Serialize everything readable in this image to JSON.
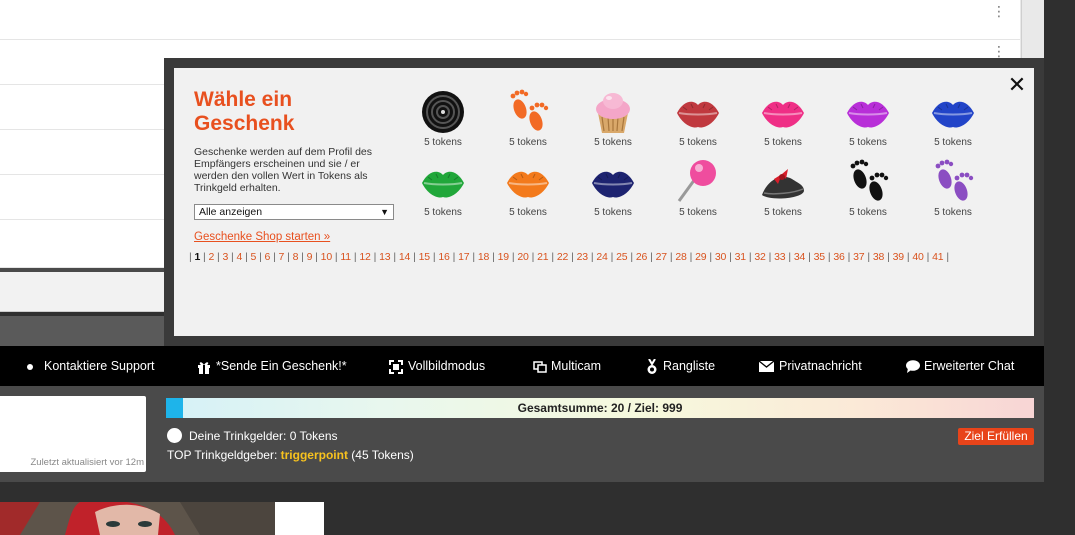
{
  "modal": {
    "title": "Wähle ein Geschenk",
    "description": "Geschenke werden auf dem Profil des Empfängers erscheinen und sie / er werden den vollen Wert in Tokens als Trinkgeld erhalten.",
    "filter_selected": "Alle anzeigen",
    "shop_link": "Geschenke Shop starten »",
    "close_glyph": "✕",
    "gifts": [
      {
        "icon": "licorice-wheel-icon",
        "label": "5 tokens"
      },
      {
        "icon": "orange-footprints-icon",
        "label": "5 tokens"
      },
      {
        "icon": "cupcake-icon",
        "label": "5 tokens"
      },
      {
        "icon": "red-lips-icon",
        "label": "5 tokens"
      },
      {
        "icon": "pink-lips-icon",
        "label": "5 tokens"
      },
      {
        "icon": "purple-lips-icon",
        "label": "5 tokens"
      },
      {
        "icon": "blue-lips-icon",
        "label": "5 tokens"
      },
      {
        "icon": "green-lips-icon",
        "label": "5 tokens"
      },
      {
        "icon": "orange-lips-icon",
        "label": "5 tokens"
      },
      {
        "icon": "navy-lips-icon",
        "label": "5 tokens"
      },
      {
        "icon": "lollipop-icon",
        "label": "5 tokens"
      },
      {
        "icon": "shoe-bow-icon",
        "label": "5 tokens"
      },
      {
        "icon": "black-footprints-icon",
        "label": "5 tokens"
      },
      {
        "icon": "purple-footprints-icon",
        "label": "5 tokens"
      }
    ],
    "pages": [
      "1",
      "2",
      "3",
      "4",
      "5",
      "6",
      "7",
      "8",
      "9",
      "10",
      "11",
      "12",
      "13",
      "14",
      "15",
      "16",
      "17",
      "18",
      "19",
      "20",
      "21",
      "22",
      "23",
      "24",
      "25",
      "26",
      "27",
      "28",
      "29",
      "30",
      "31",
      "32",
      "33",
      "34",
      "35",
      "36",
      "37",
      "38",
      "39",
      "40",
      "41"
    ],
    "current_page": "1"
  },
  "nav": {
    "support": "Kontaktiere Support",
    "gift": "*Sende Ein Geschenk!*",
    "fullscreen": "Vollbildmodus",
    "multicam": "Multicam",
    "ranking": "Rangliste",
    "message": "Privatnachricht",
    "chat": "Erweiterter Chat"
  },
  "info": {
    "updated": "Zuletzt aktualisiert vor 12m"
  },
  "goal": {
    "text": "Gesamtsumme: 20 / Ziel: 999",
    "current": 20,
    "target": 999,
    "tips_label": "Deine Trinkgelder: 0 Tokens",
    "top_tipper_prefix": "TOP Trinkgeldgeber: ",
    "top_tipper_name": "triggerpoint",
    "top_tipper_suffix": " (45 Tokens)",
    "button": "Ziel Erfüllen"
  },
  "colors": {
    "accent": "#e8501f",
    "goal_fill": "#1eb4ea",
    "tipper": "#f7c21e",
    "button": "#e8441a"
  }
}
